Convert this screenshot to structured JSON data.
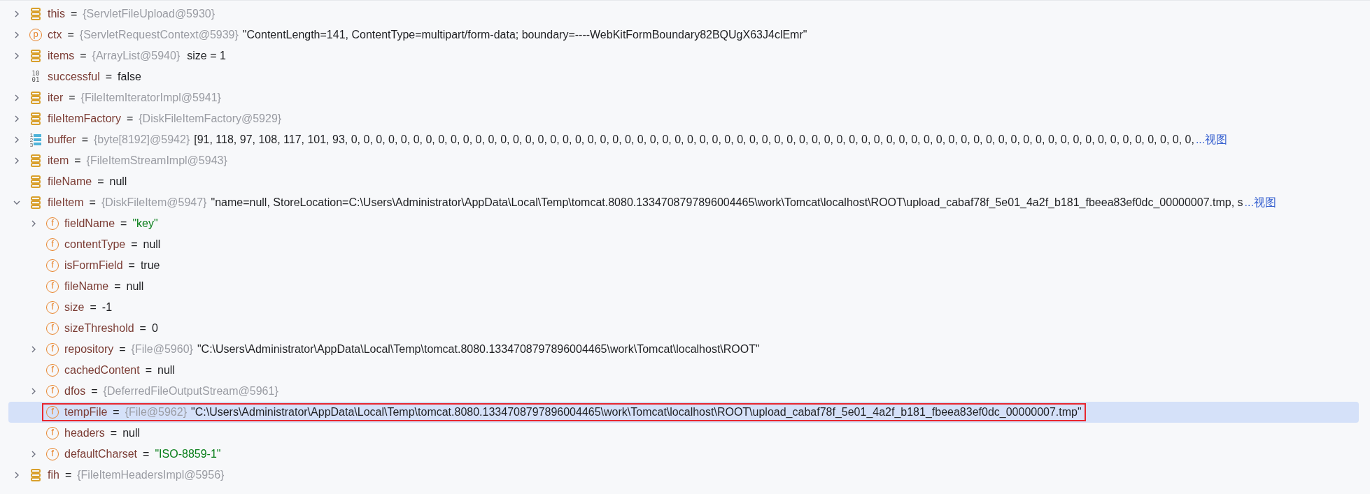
{
  "variables": [
    {
      "name": "this",
      "kind": "object",
      "equals": "=",
      "type": "{ServletFileUpload@5930}",
      "expandable": true,
      "expanded": false,
      "selected": false,
      "highlighted": false
    },
    {
      "name": "ctx",
      "kind": "param",
      "icon_label": [
        "p"
      ],
      "equals": "=",
      "type": "{ServletRequestContext@5939}",
      "value": "\"ContentLength=141, ContentType=multipart/form-data; boundary=----WebKitFormBoundary82BQUgX63J4clEmr\"",
      "string_value": false,
      "expandable": true,
      "expanded": false,
      "selected": false,
      "highlighted": false
    },
    {
      "name": "items",
      "kind": "object",
      "equals": "=",
      "type": "{ArrayList@5940}",
      "value": "size = 1",
      "string_value": false,
      "expandable": true,
      "expanded": false,
      "selected": false,
      "highlighted": false
    },
    {
      "name": "successful",
      "kind": "primitive",
      "icon_label": [
        "10",
        "01"
      ],
      "equals": "=",
      "value": "false",
      "string_value": false,
      "expandable": false,
      "selected": false,
      "highlighted": false
    },
    {
      "name": "iter",
      "kind": "object",
      "equals": "=",
      "type": "{FileItemIteratorImpl@5941}",
      "expandable": true,
      "expanded": false,
      "selected": false,
      "highlighted": false
    },
    {
      "name": "fileItemFactory",
      "kind": "object",
      "equals": "=",
      "type": "{DiskFileItemFactory@5929}",
      "expandable": true,
      "expanded": false,
      "selected": false,
      "highlighted": false
    },
    {
      "name": "buffer",
      "kind": "array",
      "icon_label": [
        "1",
        "2",
        "3"
      ],
      "equals": "=",
      "type": "{byte[8192]@5942}",
      "value": "[91, 118, 97, 108, 117, 101, 93, 0, 0, 0, 0, 0, 0, 0, 0, 0, 0, 0, 0, 0, 0, 0, 0, 0, 0, 0, 0, 0, 0, 0, 0, 0, 0, 0, 0, 0, 0, 0, 0, 0, 0, 0, 0, 0, 0, 0, 0, 0, 0, 0, 0, 0, 0, 0, 0, 0, 0, 0, 0, 0, 0, 0, 0, 0, 0, 0, 0, 0, 0, 0, 0, 0, 0, 0, 0,",
      "string_value": false,
      "more": "...视图",
      "expandable": true,
      "expanded": false,
      "selected": false,
      "highlighted": false
    },
    {
      "name": "item",
      "kind": "object",
      "equals": "=",
      "type": "{FileItemStreamImpl@5943}",
      "expandable": true,
      "expanded": false,
      "selected": false,
      "highlighted": false
    },
    {
      "name": "fileName",
      "kind": "object",
      "equals": "=",
      "value": "null",
      "string_value": false,
      "expandable": false,
      "selected": false,
      "highlighted": false
    },
    {
      "name": "fileItem",
      "kind": "object",
      "equals": "=",
      "type": "{DiskFileItem@5947}",
      "value": "\"name=null, StoreLocation=C:\\Users\\Administrator\\AppData\\Local\\Temp\\tomcat.8080.1334708797896004465\\work\\Tomcat\\localhost\\ROOT\\upload_cabaf78f_5e01_4a2f_b181_fbeea83ef0dc_00000007.tmp, s",
      "string_value": false,
      "more": "...视图",
      "expandable": true,
      "expanded": true,
      "selected": false,
      "highlighted": false,
      "children": [
        {
          "name": "fieldName",
          "kind": "field",
          "icon_label": [
            "f"
          ],
          "equals": "=",
          "value": "\"key\"",
          "string_value": true,
          "expandable": true,
          "expanded": false,
          "selected": false,
          "highlighted": false
        },
        {
          "name": "contentType",
          "kind": "field",
          "icon_label": [
            "f"
          ],
          "equals": "=",
          "value": "null",
          "string_value": false,
          "expandable": false,
          "selected": false,
          "highlighted": false
        },
        {
          "name": "isFormField",
          "kind": "field",
          "icon_label": [
            "f"
          ],
          "equals": "=",
          "value": "true",
          "string_value": false,
          "expandable": false,
          "selected": false,
          "highlighted": false
        },
        {
          "name": "fileName",
          "kind": "field",
          "icon_label": [
            "f"
          ],
          "equals": "=",
          "value": "null",
          "string_value": false,
          "expandable": false,
          "selected": false,
          "highlighted": false
        },
        {
          "name": "size",
          "kind": "field",
          "icon_label": [
            "f"
          ],
          "equals": "=",
          "value": "-1",
          "string_value": false,
          "expandable": false,
          "selected": false,
          "highlighted": false
        },
        {
          "name": "sizeThreshold",
          "kind": "field",
          "icon_label": [
            "f"
          ],
          "equals": "=",
          "value": "0",
          "string_value": false,
          "expandable": false,
          "selected": false,
          "highlighted": false
        },
        {
          "name": "repository",
          "kind": "field",
          "icon_label": [
            "f"
          ],
          "equals": "=",
          "type": "{File@5960}",
          "value": "\"C:\\Users\\Administrator\\AppData\\Local\\Temp\\tomcat.8080.1334708797896004465\\work\\Tomcat\\localhost\\ROOT\"",
          "string_value": false,
          "expandable": true,
          "expanded": false,
          "selected": false,
          "highlighted": false
        },
        {
          "name": "cachedContent",
          "kind": "field",
          "icon_label": [
            "f"
          ],
          "equals": "=",
          "value": "null",
          "string_value": false,
          "expandable": false,
          "selected": false,
          "highlighted": false
        },
        {
          "name": "dfos",
          "kind": "field",
          "icon_label": [
            "f"
          ],
          "equals": "=",
          "type": "{DeferredFileOutputStream@5961}",
          "expandable": true,
          "expanded": false,
          "selected": false,
          "highlighted": false
        },
        {
          "name": "tempFile",
          "kind": "field",
          "icon_label": [
            "f"
          ],
          "equals": "=",
          "type": "{File@5962}",
          "value": "\"C:\\Users\\Administrator\\AppData\\Local\\Temp\\tomcat.8080.1334708797896004465\\work\\Tomcat\\localhost\\ROOT\\upload_cabaf78f_5e01_4a2f_b181_fbeea83ef0dc_00000007.tmp\"",
          "string_value": false,
          "expandable": false,
          "selected": true,
          "highlighted": true
        },
        {
          "name": "headers",
          "kind": "field",
          "icon_label": [
            "f"
          ],
          "equals": "=",
          "value": "null",
          "string_value": false,
          "expandable": false,
          "selected": false,
          "highlighted": false
        },
        {
          "name": "defaultCharset",
          "kind": "field",
          "icon_label": [
            "f"
          ],
          "equals": "=",
          "value": "\"ISO-8859-1\"",
          "string_value": true,
          "expandable": true,
          "expanded": false,
          "selected": false,
          "highlighted": false
        }
      ]
    },
    {
      "name": "fih",
      "kind": "object",
      "equals": "=",
      "type": "{FileItemHeadersImpl@5956}",
      "expandable": true,
      "expanded": false,
      "selected": false,
      "highlighted": false
    }
  ]
}
